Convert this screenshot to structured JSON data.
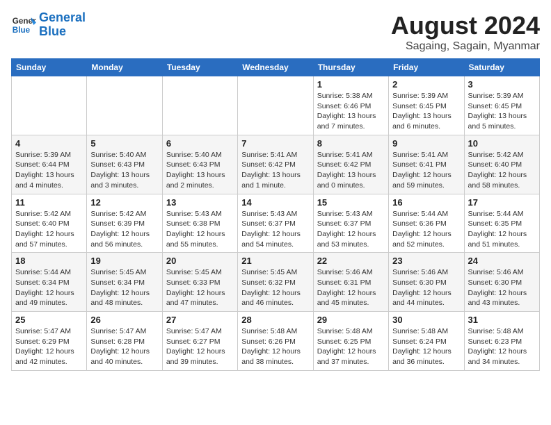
{
  "logo": {
    "line1": "General",
    "line2": "Blue"
  },
  "title": "August 2024",
  "subtitle": "Sagaing, Sagain, Myanmar",
  "weekdays": [
    "Sunday",
    "Monday",
    "Tuesday",
    "Wednesday",
    "Thursday",
    "Friday",
    "Saturday"
  ],
  "weeks": [
    [
      {
        "day": "",
        "info": ""
      },
      {
        "day": "",
        "info": ""
      },
      {
        "day": "",
        "info": ""
      },
      {
        "day": "",
        "info": ""
      },
      {
        "day": "1",
        "info": "Sunrise: 5:38 AM\nSunset: 6:46 PM\nDaylight: 13 hours and 7 minutes."
      },
      {
        "day": "2",
        "info": "Sunrise: 5:39 AM\nSunset: 6:45 PM\nDaylight: 13 hours and 6 minutes."
      },
      {
        "day": "3",
        "info": "Sunrise: 5:39 AM\nSunset: 6:45 PM\nDaylight: 13 hours and 5 minutes."
      }
    ],
    [
      {
        "day": "4",
        "info": "Sunrise: 5:39 AM\nSunset: 6:44 PM\nDaylight: 13 hours and 4 minutes."
      },
      {
        "day": "5",
        "info": "Sunrise: 5:40 AM\nSunset: 6:43 PM\nDaylight: 13 hours and 3 minutes."
      },
      {
        "day": "6",
        "info": "Sunrise: 5:40 AM\nSunset: 6:43 PM\nDaylight: 13 hours and 2 minutes."
      },
      {
        "day": "7",
        "info": "Sunrise: 5:41 AM\nSunset: 6:42 PM\nDaylight: 13 hours and 1 minute."
      },
      {
        "day": "8",
        "info": "Sunrise: 5:41 AM\nSunset: 6:42 PM\nDaylight: 13 hours and 0 minutes."
      },
      {
        "day": "9",
        "info": "Sunrise: 5:41 AM\nSunset: 6:41 PM\nDaylight: 12 hours and 59 minutes."
      },
      {
        "day": "10",
        "info": "Sunrise: 5:42 AM\nSunset: 6:40 PM\nDaylight: 12 hours and 58 minutes."
      }
    ],
    [
      {
        "day": "11",
        "info": "Sunrise: 5:42 AM\nSunset: 6:40 PM\nDaylight: 12 hours and 57 minutes."
      },
      {
        "day": "12",
        "info": "Sunrise: 5:42 AM\nSunset: 6:39 PM\nDaylight: 12 hours and 56 minutes."
      },
      {
        "day": "13",
        "info": "Sunrise: 5:43 AM\nSunset: 6:38 PM\nDaylight: 12 hours and 55 minutes."
      },
      {
        "day": "14",
        "info": "Sunrise: 5:43 AM\nSunset: 6:37 PM\nDaylight: 12 hours and 54 minutes."
      },
      {
        "day": "15",
        "info": "Sunrise: 5:43 AM\nSunset: 6:37 PM\nDaylight: 12 hours and 53 minutes."
      },
      {
        "day": "16",
        "info": "Sunrise: 5:44 AM\nSunset: 6:36 PM\nDaylight: 12 hours and 52 minutes."
      },
      {
        "day": "17",
        "info": "Sunrise: 5:44 AM\nSunset: 6:35 PM\nDaylight: 12 hours and 51 minutes."
      }
    ],
    [
      {
        "day": "18",
        "info": "Sunrise: 5:44 AM\nSunset: 6:34 PM\nDaylight: 12 hours and 49 minutes."
      },
      {
        "day": "19",
        "info": "Sunrise: 5:45 AM\nSunset: 6:34 PM\nDaylight: 12 hours and 48 minutes."
      },
      {
        "day": "20",
        "info": "Sunrise: 5:45 AM\nSunset: 6:33 PM\nDaylight: 12 hours and 47 minutes."
      },
      {
        "day": "21",
        "info": "Sunrise: 5:45 AM\nSunset: 6:32 PM\nDaylight: 12 hours and 46 minutes."
      },
      {
        "day": "22",
        "info": "Sunrise: 5:46 AM\nSunset: 6:31 PM\nDaylight: 12 hours and 45 minutes."
      },
      {
        "day": "23",
        "info": "Sunrise: 5:46 AM\nSunset: 6:30 PM\nDaylight: 12 hours and 44 minutes."
      },
      {
        "day": "24",
        "info": "Sunrise: 5:46 AM\nSunset: 6:30 PM\nDaylight: 12 hours and 43 minutes."
      }
    ],
    [
      {
        "day": "25",
        "info": "Sunrise: 5:47 AM\nSunset: 6:29 PM\nDaylight: 12 hours and 42 minutes."
      },
      {
        "day": "26",
        "info": "Sunrise: 5:47 AM\nSunset: 6:28 PM\nDaylight: 12 hours and 40 minutes."
      },
      {
        "day": "27",
        "info": "Sunrise: 5:47 AM\nSunset: 6:27 PM\nDaylight: 12 hours and 39 minutes."
      },
      {
        "day": "28",
        "info": "Sunrise: 5:48 AM\nSunset: 6:26 PM\nDaylight: 12 hours and 38 minutes."
      },
      {
        "day": "29",
        "info": "Sunrise: 5:48 AM\nSunset: 6:25 PM\nDaylight: 12 hours and 37 minutes."
      },
      {
        "day": "30",
        "info": "Sunrise: 5:48 AM\nSunset: 6:24 PM\nDaylight: 12 hours and 36 minutes."
      },
      {
        "day": "31",
        "info": "Sunrise: 5:48 AM\nSunset: 6:23 PM\nDaylight: 12 hours and 34 minutes."
      }
    ]
  ]
}
